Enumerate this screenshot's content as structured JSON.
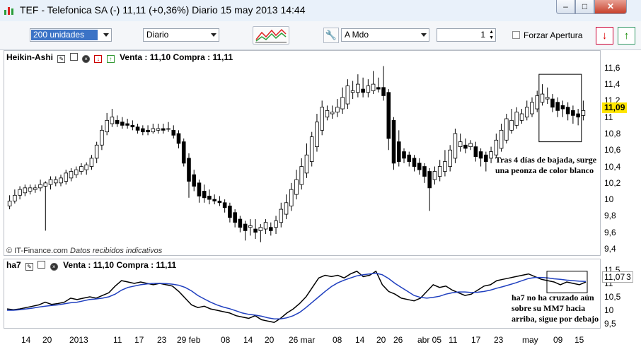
{
  "window": {
    "title": "TEF - Telefonica SA (-)    11,11 (+0,36%)    Diario  15 may 2013 14:44",
    "minimize_glyph": "–",
    "maximize_glyph": "□",
    "close_glyph": "✕"
  },
  "toolbar": {
    "units": "200 unidades",
    "period": "Diario",
    "order_type": "A Mdo",
    "quantity": "1",
    "force_open_label": "Forzar Apertura",
    "sell_glyph": "↓",
    "buy_glyph": "↑",
    "wrench_icon": "wrench-icon"
  },
  "main_panel": {
    "title": "Heikin-Ashi",
    "quote": "Venta : 11,10 Compra : 11,11",
    "copyright": "© IT-Finance.com",
    "disclaimer": "Datos recibidos indicativos",
    "price_tag": "11,09",
    "annotation": [
      "Tras 4 días de bajada, surge",
      "una peonza de color blanco"
    ]
  },
  "osc_panel": {
    "title": "ha7",
    "quote": "Venta : 11,10 Compra : 11,11",
    "value_tag": "11,07",
    "value_tag_suffix": "3",
    "annotation": [
      "ha7 no ha cruzado aún",
      "sobre su MM7 hacia",
      "arriba, sigue por debajo"
    ]
  },
  "colors": {
    "up": "#ffffff",
    "down": "#000000",
    "ma": "#1f3fbf",
    "ha": "#000000",
    "price_tag": "#ffe600"
  },
  "chart_data": [
    {
      "type": "candlestick",
      "title": "Heikin-Ashi",
      "ylim": [
        9.4,
        11.65
      ],
      "yticks": [
        "11,6",
        "11,4",
        "11,2",
        "11",
        "10,8",
        "10,6",
        "10,4",
        "10,2",
        "10",
        "9,8",
        "9,6",
        "9,4"
      ],
      "candles": [
        [
          9.92,
          9.98,
          9.88,
          10.05
        ],
        [
          9.98,
          10.05,
          9.95,
          10.12
        ],
        [
          10.05,
          10.12,
          10.0,
          10.16
        ],
        [
          10.08,
          10.14,
          10.04,
          10.18
        ],
        [
          10.1,
          10.14,
          10.06,
          10.18
        ],
        [
          10.12,
          10.14,
          10.08,
          10.18
        ],
        [
          10.14,
          10.18,
          10.1,
          10.24
        ],
        [
          10.16,
          10.2,
          9.62,
          10.22
        ],
        [
          10.18,
          10.24,
          10.12,
          10.28
        ],
        [
          10.2,
          10.24,
          10.16,
          10.28
        ],
        [
          10.2,
          10.26,
          10.16,
          10.3
        ],
        [
          10.22,
          10.32,
          10.18,
          10.36
        ],
        [
          10.26,
          10.34,
          10.22,
          10.38
        ],
        [
          10.3,
          10.36,
          10.26,
          10.4
        ],
        [
          10.34,
          10.4,
          10.3,
          10.44
        ],
        [
          10.36,
          10.42,
          10.3,
          10.45
        ],
        [
          10.4,
          10.5,
          10.36,
          10.54
        ],
        [
          10.5,
          10.66,
          10.44,
          10.7
        ],
        [
          10.66,
          10.84,
          10.6,
          10.9
        ],
        [
          10.82,
          10.96,
          10.78,
          11.05
        ],
        [
          10.92,
          11.0,
          10.88,
          11.1
        ],
        [
          10.96,
          10.92,
          10.88,
          11.02
        ],
        [
          10.94,
          10.9,
          10.86,
          11.0
        ],
        [
          10.92,
          10.9,
          10.86,
          10.98
        ],
        [
          10.9,
          10.88,
          10.84,
          10.96
        ],
        [
          10.88,
          10.84,
          10.8,
          10.92
        ],
        [
          10.86,
          10.82,
          10.78,
          10.9
        ],
        [
          10.84,
          10.82,
          10.78,
          10.9
        ],
        [
          10.82,
          10.86,
          10.8,
          10.92
        ],
        [
          10.84,
          10.86,
          10.8,
          10.92
        ],
        [
          10.86,
          10.84,
          10.8,
          10.92
        ],
        [
          10.86,
          10.86,
          10.82,
          10.94
        ],
        [
          10.84,
          10.78,
          10.74,
          10.9
        ],
        [
          10.8,
          10.68,
          10.62,
          10.84
        ],
        [
          10.7,
          10.44,
          10.4,
          10.74
        ],
        [
          10.5,
          10.22,
          10.02,
          10.56
        ],
        [
          10.3,
          10.16,
          10.1,
          10.36
        ],
        [
          10.2,
          10.04,
          9.96,
          10.24
        ],
        [
          10.1,
          10.02,
          9.96,
          10.18
        ],
        [
          10.04,
          10.0,
          9.94,
          10.12
        ],
        [
          10.0,
          9.98,
          9.94,
          10.06
        ],
        [
          9.98,
          9.96,
          9.92,
          10.04
        ],
        [
          9.96,
          9.9,
          9.84,
          10.0
        ],
        [
          9.92,
          9.78,
          9.72,
          9.96
        ],
        [
          9.84,
          9.72,
          9.66,
          9.88
        ],
        [
          9.76,
          9.66,
          9.6,
          9.8
        ],
        [
          9.7,
          9.62,
          9.5,
          9.74
        ],
        [
          9.66,
          9.68,
          9.56,
          9.76
        ],
        [
          9.64,
          9.6,
          9.52,
          9.76
        ],
        [
          9.62,
          9.66,
          9.48,
          9.7
        ],
        [
          9.64,
          9.72,
          9.58,
          9.76
        ],
        [
          9.66,
          9.62,
          9.56,
          9.72
        ],
        [
          9.66,
          9.74,
          9.58,
          9.8
        ],
        [
          9.72,
          9.88,
          9.66,
          9.96
        ],
        [
          9.82,
          9.96,
          9.76,
          10.06
        ],
        [
          9.92,
          10.12,
          9.86,
          10.2
        ],
        [
          10.06,
          10.24,
          10.0,
          10.36
        ],
        [
          10.18,
          10.4,
          10.12,
          10.5
        ],
        [
          10.32,
          10.54,
          10.26,
          10.68
        ],
        [
          10.46,
          10.76,
          10.4,
          10.82
        ],
        [
          10.64,
          10.94,
          10.58,
          11.04
        ],
        [
          10.84,
          11.12,
          10.78,
          11.2
        ],
        [
          11.0,
          11.08,
          10.96,
          11.14
        ],
        [
          11.04,
          11.06,
          10.98,
          11.14
        ],
        [
          11.06,
          11.12,
          11.0,
          11.22
        ],
        [
          11.1,
          11.24,
          11.04,
          11.36
        ],
        [
          11.16,
          11.38,
          11.1,
          11.46
        ],
        [
          11.3,
          11.32,
          11.22,
          11.44
        ],
        [
          11.3,
          11.4,
          11.24,
          11.52
        ],
        [
          11.34,
          11.3,
          11.24,
          11.48
        ],
        [
          11.3,
          11.38,
          11.24,
          11.46
        ],
        [
          11.32,
          11.4,
          11.28,
          11.56
        ],
        [
          11.36,
          11.34,
          11.3,
          11.48
        ],
        [
          11.36,
          11.26,
          11.2,
          11.62
        ],
        [
          11.3,
          10.74,
          10.6,
          11.34
        ],
        [
          10.96,
          10.44,
          10.36,
          11.0
        ],
        [
          10.7,
          10.46,
          10.4,
          10.84
        ],
        [
          10.58,
          10.5,
          10.44,
          10.62
        ],
        [
          10.54,
          10.46,
          10.4,
          10.58
        ],
        [
          10.5,
          10.4,
          10.34,
          10.54
        ],
        [
          10.44,
          10.36,
          10.3,
          10.5
        ],
        [
          10.4,
          10.28,
          10.2,
          10.44
        ],
        [
          10.34,
          10.14,
          9.86,
          10.38
        ],
        [
          10.24,
          10.34,
          10.18,
          10.4
        ],
        [
          10.28,
          10.4,
          10.22,
          10.48
        ],
        [
          10.34,
          10.46,
          10.28,
          10.6
        ],
        [
          10.4,
          10.6,
          10.34,
          10.66
        ],
        [
          10.5,
          10.8,
          10.44,
          10.86
        ],
        [
          10.64,
          10.7,
          10.58,
          10.8
        ],
        [
          10.66,
          10.62,
          10.56,
          10.74
        ],
        [
          10.64,
          10.68,
          10.6,
          10.72
        ],
        [
          10.64,
          10.52,
          10.46,
          10.7
        ],
        [
          10.58,
          10.5,
          10.4,
          10.62
        ],
        [
          10.54,
          10.46,
          10.34,
          10.58
        ],
        [
          10.5,
          10.58,
          10.44,
          10.64
        ],
        [
          10.54,
          10.72,
          10.5,
          10.8
        ],
        [
          10.62,
          10.84,
          10.58,
          10.92
        ],
        [
          10.72,
          10.98,
          10.68,
          11.04
        ],
        [
          10.84,
          10.96,
          10.8,
          11.1
        ],
        [
          10.9,
          11.06,
          10.86,
          11.12
        ],
        [
          10.96,
          11.04,
          10.92,
          11.1
        ],
        [
          11.0,
          11.12,
          10.96,
          11.2
        ],
        [
          11.04,
          11.18,
          11.0,
          11.24
        ],
        [
          11.1,
          11.26,
          11.06,
          11.32
        ],
        [
          11.18,
          11.28,
          11.14,
          11.4
        ],
        [
          11.22,
          11.24,
          11.16,
          11.36
        ],
        [
          11.22,
          11.12,
          11.06,
          11.28
        ],
        [
          11.18,
          11.08,
          11.0,
          11.24
        ],
        [
          11.14,
          11.1,
          11.0,
          11.2
        ],
        [
          11.12,
          11.04,
          10.96,
          11.18
        ],
        [
          11.08,
          11.02,
          10.92,
          11.14
        ],
        [
          11.04,
          11.0,
          10.9,
          11.1
        ],
        [
          11.02,
          11.08,
          10.96,
          11.2
        ]
      ],
      "xlabels": [
        "14",
        "20",
        "2013",
        "11",
        "17",
        "23",
        "29 feb",
        "08",
        "14",
        "20",
        "26 mar",
        "08",
        "14",
        "20",
        "26",
        "abr 05",
        "11",
        "17",
        "23",
        "may",
        "09",
        "15"
      ],
      "highlight_box": {
        "from_candle": 104,
        "to_candle": 111,
        "low": 10.7,
        "high": 11.52
      }
    },
    {
      "type": "line",
      "title": "ha7",
      "ylim": [
        9.45,
        11.55
      ],
      "yticks": [
        "11,5",
        "11",
        "10,5",
        "10",
        "9,5"
      ],
      "series": [
        {
          "name": "ha7",
          "values": [
            10.05,
            10.02,
            10.05,
            10.1,
            10.15,
            10.2,
            10.3,
            10.22,
            10.25,
            10.3,
            10.45,
            10.4,
            10.45,
            10.5,
            10.45,
            10.55,
            10.65,
            10.9,
            11.1,
            11.05,
            11.0,
            11.05,
            11.0,
            10.95,
            11.0,
            10.95,
            10.9,
            10.7,
            10.45,
            10.2,
            10.1,
            10.15,
            10.05,
            10.0,
            9.95,
            9.9,
            9.8,
            9.75,
            9.7,
            9.8,
            9.65,
            9.6,
            9.55,
            9.7,
            9.9,
            10.05,
            10.25,
            10.5,
            10.85,
            11.2,
            11.3,
            11.25,
            11.3,
            11.2,
            11.35,
            11.45,
            11.25,
            11.3,
            11.45,
            10.95,
            10.7,
            10.6,
            10.45,
            10.4,
            10.35,
            10.45,
            10.7,
            10.95,
            10.85,
            10.9,
            10.75,
            10.65,
            10.55,
            10.6,
            10.75,
            10.9,
            10.95,
            11.1,
            11.15,
            11.2,
            11.25,
            11.3,
            11.35,
            11.25,
            11.15,
            11.1,
            11.05,
            10.95,
            11.05,
            11.0,
            10.95,
            11.05
          ]
        },
        {
          "name": "MM7",
          "values": [
            10.0,
            10.0,
            10.02,
            10.05,
            10.08,
            10.12,
            10.15,
            10.18,
            10.2,
            10.24,
            10.28,
            10.3,
            10.35,
            10.4,
            10.42,
            10.45,
            10.5,
            10.6,
            10.75,
            10.85,
            10.9,
            10.95,
            10.98,
            11.0,
            11.0,
            10.99,
            10.97,
            10.93,
            10.85,
            10.72,
            10.55,
            10.42,
            10.3,
            10.2,
            10.12,
            10.06,
            9.98,
            9.9,
            9.85,
            9.82,
            9.78,
            9.72,
            9.68,
            9.68,
            9.72,
            9.8,
            9.92,
            10.1,
            10.3,
            10.5,
            10.7,
            10.88,
            11.02,
            11.12,
            11.2,
            11.28,
            11.32,
            11.35,
            11.38,
            11.32,
            11.18,
            11.0,
            10.85,
            10.7,
            10.55,
            10.48,
            10.45,
            10.48,
            10.52,
            10.6,
            10.65,
            10.68,
            10.68,
            10.66,
            10.67,
            10.7,
            10.75,
            10.82,
            10.88,
            10.95,
            11.02,
            11.1,
            11.18,
            11.22,
            11.22,
            11.2,
            11.17,
            11.15,
            11.12,
            11.1,
            11.08,
            11.07
          ]
        }
      ],
      "highlight_box": {
        "low": 10.65,
        "high": 11.45
      }
    }
  ]
}
